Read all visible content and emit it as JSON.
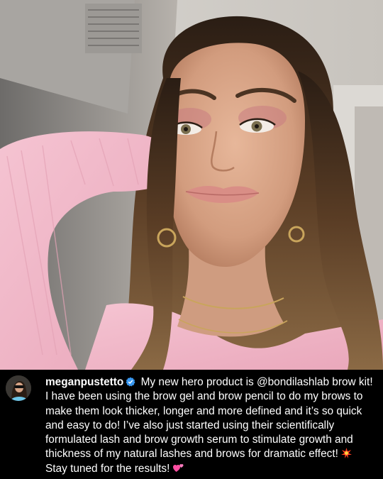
{
  "post": {
    "username": "meganpustetto",
    "verified": true,
    "caption_part1": " My new hero product is @bondilashlab brow kit! I have been using the brow gel and brow pencil to do my brows to make them look thicker, longer and more defined and it’s so quick and easy to do! I’ve also just started using their scientifically formulated lash and brow growth serum to stimulate growth and thickness of my natural lashes and brows for dramatic effect! ",
    "caption_part2": " Stay tuned for the results! ",
    "emoji1": "sparkle-burst-icon",
    "emoji2": "two-hearts-icon"
  },
  "colors": {
    "background": "#000000",
    "text": "#ffffff",
    "verified_badge": "#3897f0",
    "sweater_pink": "#f2b8c8"
  }
}
